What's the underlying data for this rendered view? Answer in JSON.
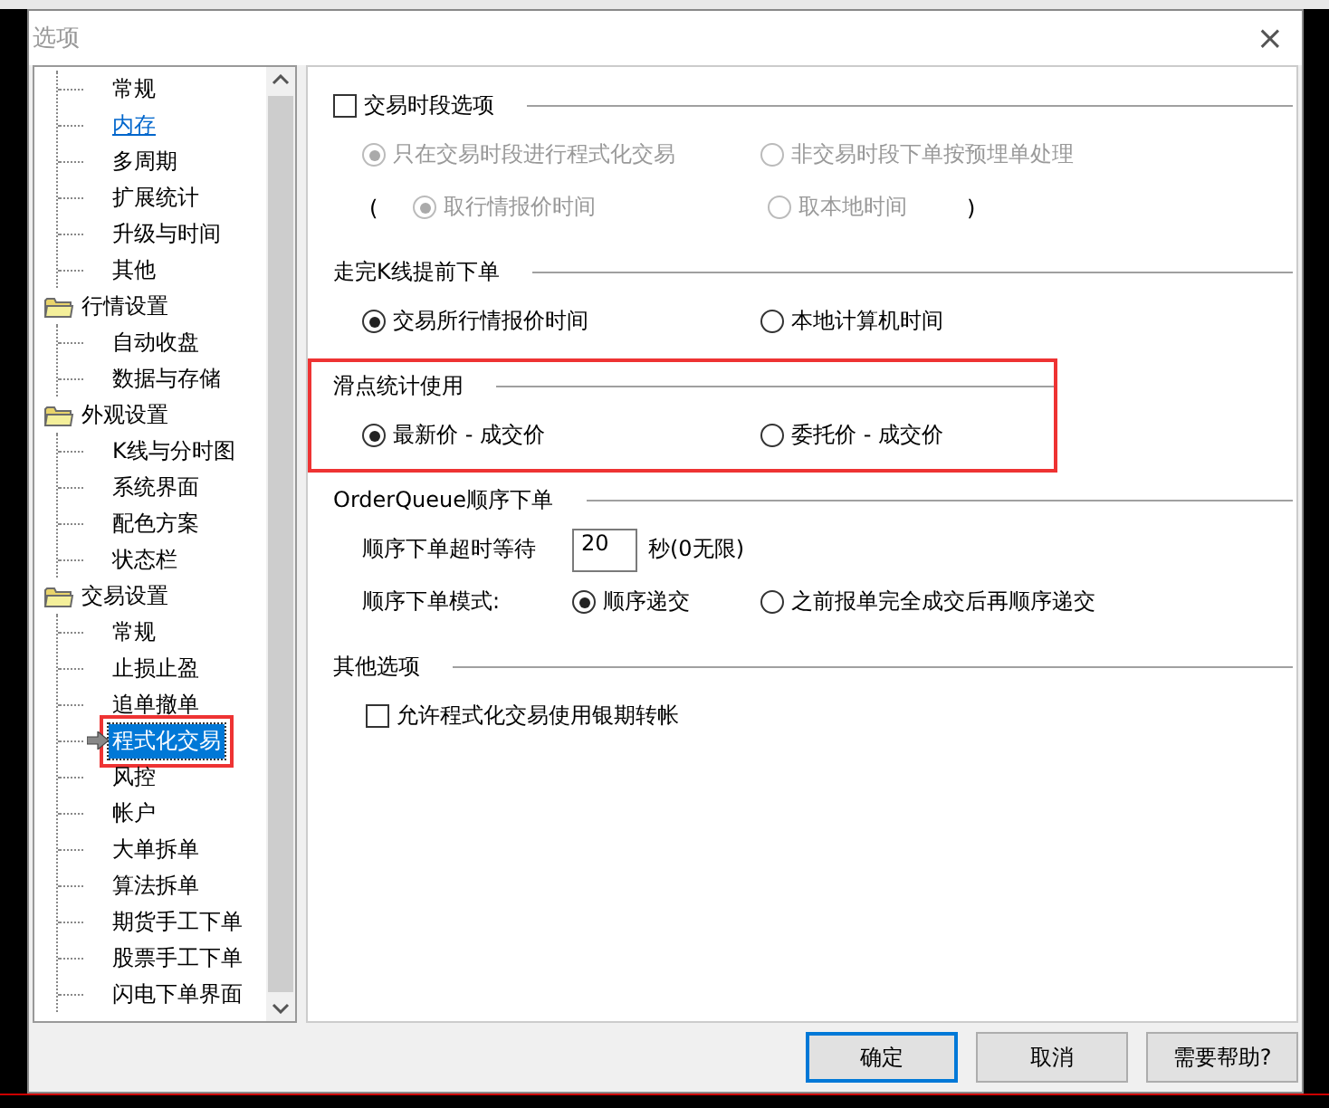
{
  "window": {
    "title": "选项",
    "close": "×"
  },
  "tree": [
    {
      "children": [
        {
          "label": "常规",
          "selected": false,
          "hot": false,
          "highlighted": false
        },
        {
          "label": "内存",
          "selected": false,
          "hot": true,
          "highlighted": false
        },
        {
          "label": "多周期",
          "selected": false,
          "hot": false,
          "highlighted": false
        },
        {
          "label": "扩展统计",
          "selected": false,
          "hot": false,
          "highlighted": false
        },
        {
          "label": "升级与时间",
          "selected": false,
          "hot": false,
          "highlighted": false
        },
        {
          "label": "其他",
          "selected": false,
          "hot": false,
          "highlighted": false
        }
      ]
    },
    {
      "label": "行情设置",
      "children": [
        {
          "label": "自动收盘",
          "selected": false,
          "hot": false,
          "highlighted": false
        },
        {
          "label": "数据与存储",
          "selected": false,
          "hot": false,
          "highlighted": false
        }
      ]
    },
    {
      "label": "外观设置",
      "children": [
        {
          "label": "K线与分时图",
          "selected": false,
          "hot": false,
          "highlighted": false
        },
        {
          "label": "系统界面",
          "selected": false,
          "hot": false,
          "highlighted": false
        },
        {
          "label": "配色方案",
          "selected": false,
          "hot": false,
          "highlighted": false
        },
        {
          "label": "状态栏",
          "selected": false,
          "hot": false,
          "highlighted": false
        }
      ]
    },
    {
      "label": "交易设置",
      "children": [
        {
          "label": "常规",
          "selected": false,
          "hot": false,
          "highlighted": false
        },
        {
          "label": "止损止盈",
          "selected": false,
          "hot": false,
          "highlighted": false
        },
        {
          "label": "追单撤单",
          "selected": false,
          "hot": false,
          "highlighted": false
        },
        {
          "label": "程式化交易",
          "selected": true,
          "hot": false,
          "highlighted": true
        },
        {
          "label": "风控",
          "selected": false,
          "hot": false,
          "highlighted": false
        },
        {
          "label": "帐户",
          "selected": false,
          "hot": false,
          "highlighted": false
        },
        {
          "label": "大单拆单",
          "selected": false,
          "hot": false,
          "highlighted": false
        },
        {
          "label": "算法拆单",
          "selected": false,
          "hot": false,
          "highlighted": false
        },
        {
          "label": "期货手工下单",
          "selected": false,
          "hot": false,
          "highlighted": false
        },
        {
          "label": "股票手工下单",
          "selected": false,
          "hot": false,
          "highlighted": false
        },
        {
          "label": "闪电下单界面",
          "selected": false,
          "hot": false,
          "highlighted": false
        }
      ]
    }
  ],
  "sections": [
    {
      "title": "交易时段选项",
      "checked": false,
      "highlighted": false,
      "rows": [
        {
          "kind": "radios",
          "options": [
            {
              "label": "只在交易时段进行程式化交易",
              "selected": true,
              "disabled": true
            },
            {
              "label": "非交易时段下单按预埋单处理",
              "selected": false,
              "disabled": true
            }
          ]
        },
        {
          "kind": "paren",
          "open": "(",
          "close": ")",
          "options": [
            {
              "label": "取行情报价时间",
              "selected": true,
              "disabled": true
            },
            {
              "label": "取本地时间",
              "selected": false,
              "disabled": true
            }
          ]
        }
      ]
    },
    {
      "title": "走完K线提前下单",
      "highlighted": false,
      "rows": [
        {
          "kind": "radios",
          "options": [
            {
              "label": "交易所行情报价时间",
              "selected": true,
              "disabled": false
            },
            {
              "label": "本地计算机时间",
              "selected": false,
              "disabled": false
            }
          ]
        }
      ]
    },
    {
      "title": "滑点统计使用",
      "highlighted": true,
      "rows": [
        {
          "kind": "radios",
          "options": [
            {
              "label": "最新价 - 成交价",
              "selected": true,
              "disabled": false
            },
            {
              "label": "委托价 - 成交价",
              "selected": false,
              "disabled": false
            }
          ]
        }
      ]
    },
    {
      "title": "OrderQueue顺序下单",
      "highlighted": false,
      "rows": [
        {
          "kind": "input",
          "label": "顺序下单超时等待",
          "value": "20",
          "suffix": "秒(0无限)"
        },
        {
          "kind": "radios",
          "label": "顺序下单模式:",
          "options": [
            {
              "label": "顺序递交",
              "selected": true,
              "disabled": false
            },
            {
              "label": "之前报单完全成交后再顺序递交",
              "selected": false,
              "disabled": false
            }
          ]
        }
      ]
    },
    {
      "title": "其他选项",
      "highlighted": false,
      "rows": [
        {
          "kind": "checkbox",
          "label": "允许程式化交易使用银期转帐",
          "checked": false
        }
      ]
    }
  ],
  "buttons": [
    {
      "label": "确定",
      "default": true
    },
    {
      "label": "取消",
      "default": false
    },
    {
      "label": "需要帮助?",
      "default": false
    }
  ]
}
